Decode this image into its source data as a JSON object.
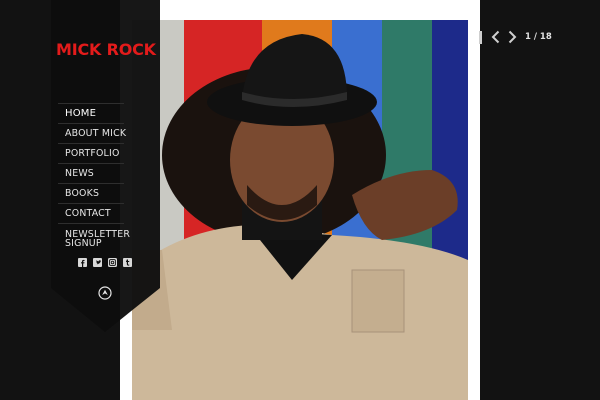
{
  "site": {
    "logo_text": "MICK ROCK",
    "brand_color": "#e31b1b"
  },
  "nav": {
    "items": [
      {
        "label": "HOME",
        "active": true
      },
      {
        "label": "ABOUT MICK",
        "active": false
      },
      {
        "label": "PORTFOLIO",
        "active": false
      },
      {
        "label": "NEWS",
        "active": false
      },
      {
        "label": "BOOKS",
        "active": false
      },
      {
        "label": "CONTACT",
        "active": false
      },
      {
        "label": "NEWSLETTER SIGNUP",
        "active": false
      }
    ]
  },
  "social": {
    "icons": [
      "facebook-icon",
      "twitter-icon",
      "instagram-icon",
      "tumblr-icon"
    ]
  },
  "gallery": {
    "current": 1,
    "total": 18,
    "counter_text": "1 / 18"
  },
  "icons": {
    "scroll_top": "up-arrow-circle-icon",
    "prev": "chevron-left-icon",
    "next": "chevron-right-icon",
    "grid": "grid-bar-icon"
  }
}
